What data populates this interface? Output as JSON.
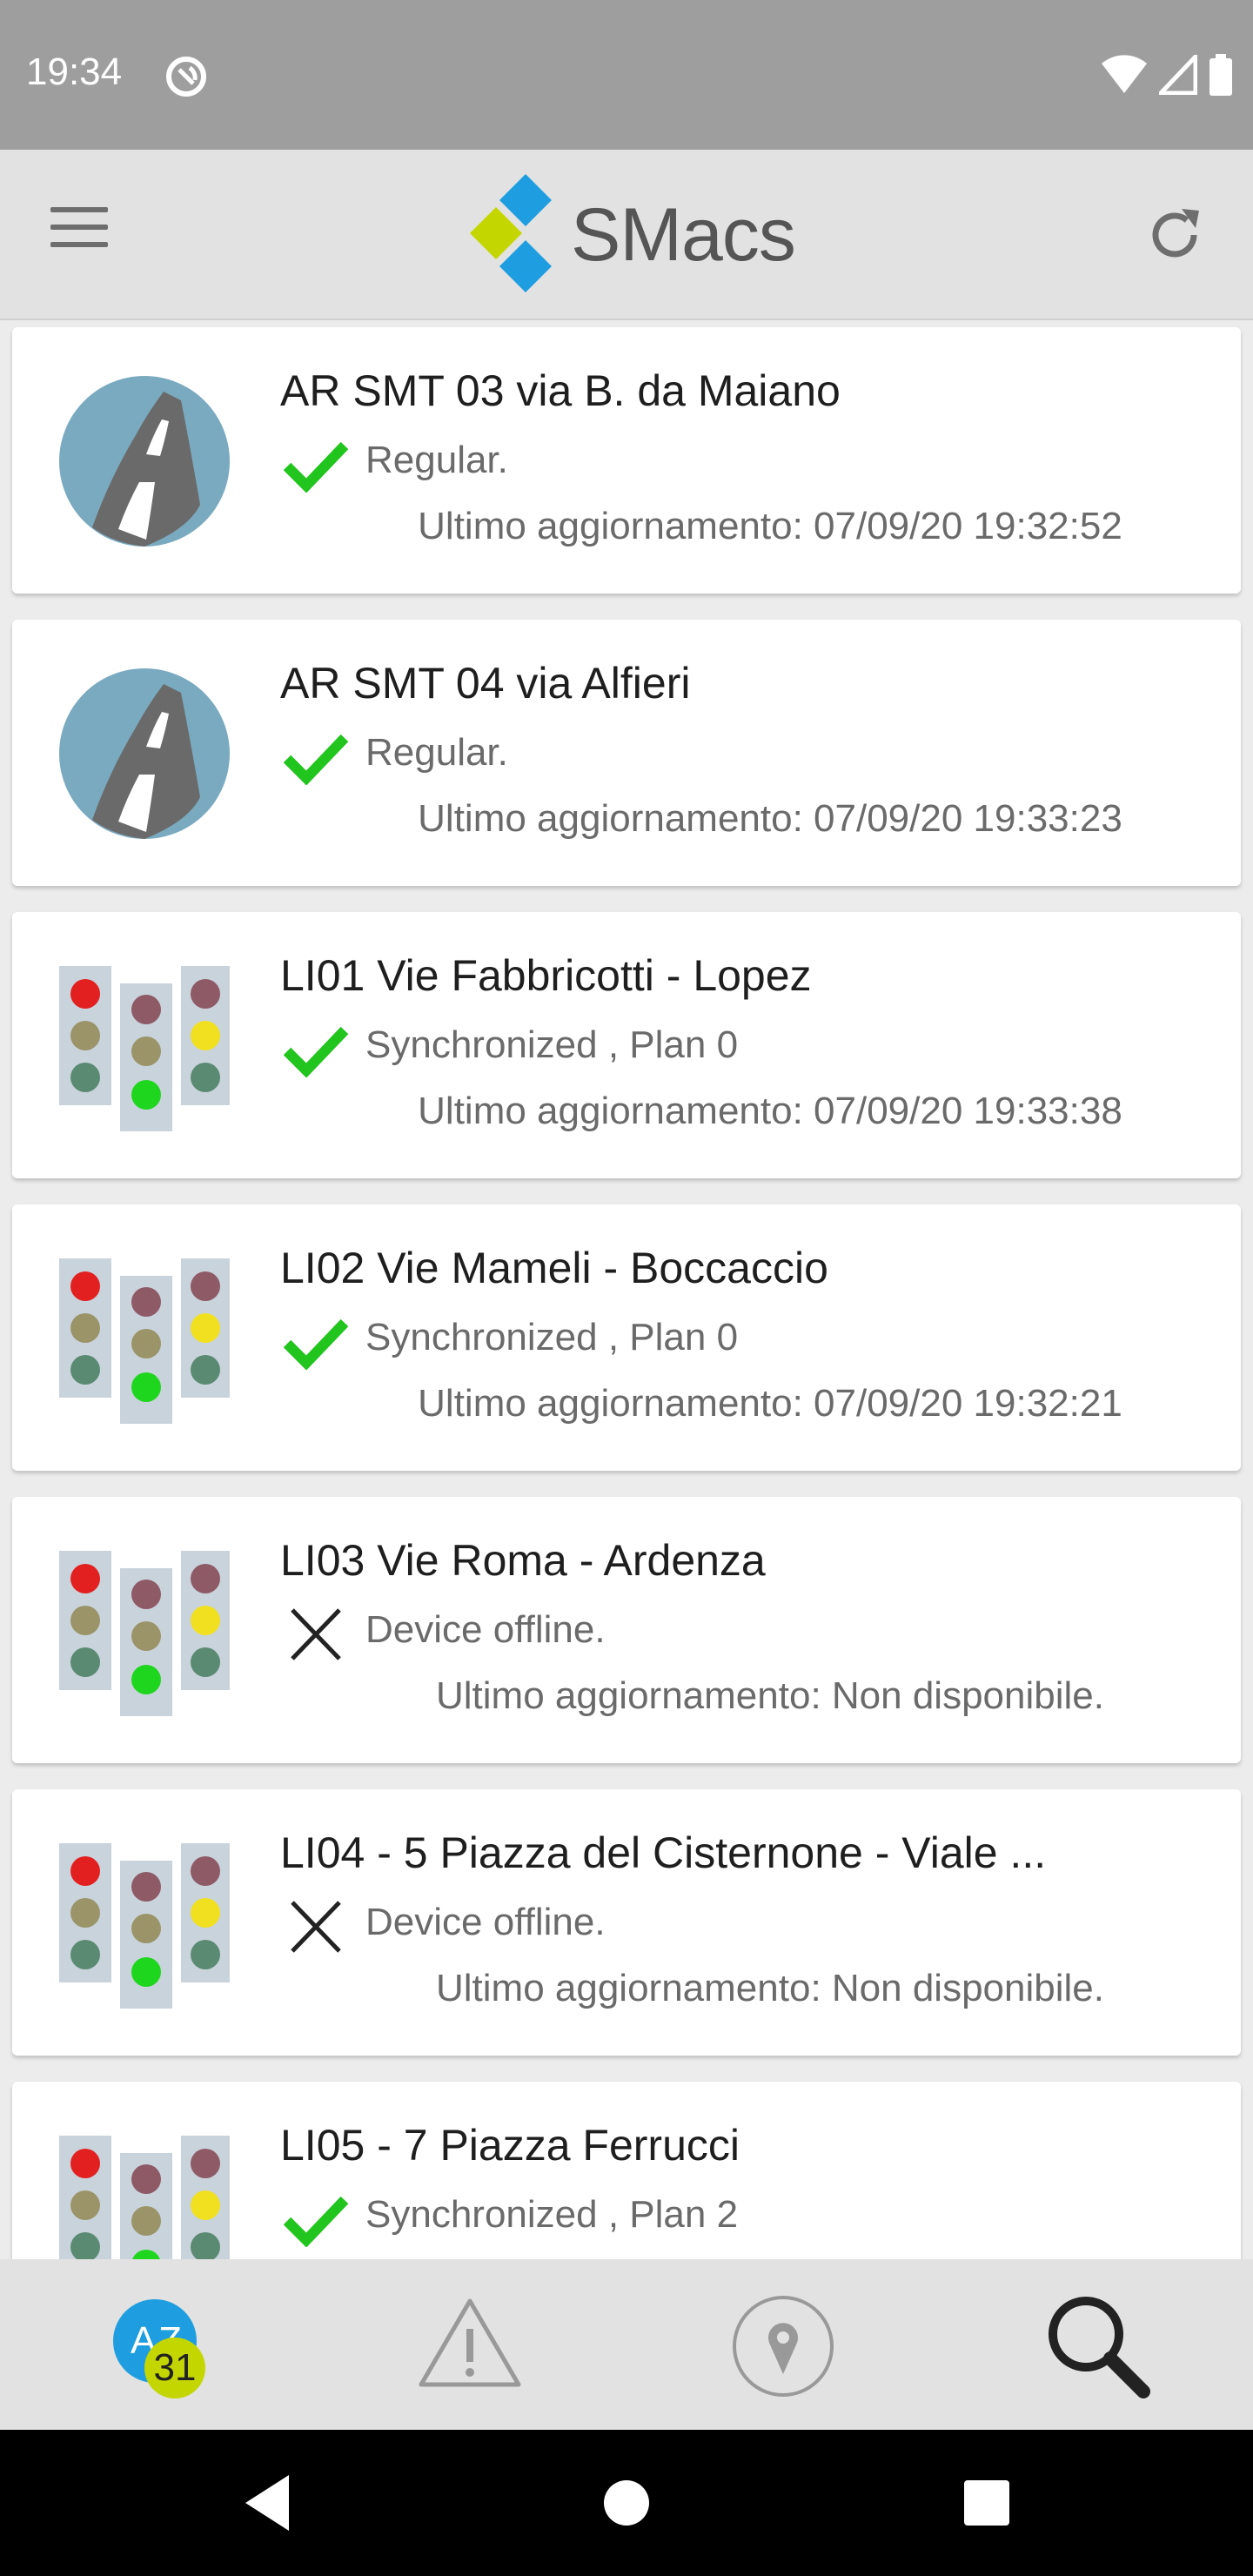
{
  "status_bar": {
    "time": "19:34",
    "sync_icon": "sync-icon",
    "wifi_icon": "wifi-icon",
    "signal_icon": "signal-icon",
    "battery_icon": "battery-icon"
  },
  "app_bar": {
    "title": "SMacs",
    "menu_icon": "menu-icon",
    "refresh_icon": "refresh-icon"
  },
  "colors": {
    "accent_green": "#22c41e",
    "logo_blue": "#1e9ee0",
    "logo_lime": "#c4d600",
    "badge": "#c4d600"
  },
  "devices": [
    {
      "title": "AR SMT 03 via B. da Maiano",
      "icon": "road-icon",
      "status_icon": "check-icon",
      "status": "Regular.",
      "update": "Ultimo aggiornamento: 07/09/20 19:32:52"
    },
    {
      "title": "AR SMT 04 via Alfieri",
      "icon": "road-icon",
      "status_icon": "check-icon",
      "status": "Regular.",
      "update": "Ultimo aggiornamento: 07/09/20 19:33:23"
    },
    {
      "title": "LI01 Vie Fabbricotti - Lopez",
      "icon": "traffic-light-icon",
      "status_icon": "check-icon",
      "status": "Synchronized , Plan 0",
      "update": "Ultimo aggiornamento: 07/09/20 19:33:38"
    },
    {
      "title": "LI02 Vie Mameli - Boccaccio",
      "icon": "traffic-light-icon",
      "status_icon": "check-icon",
      "status": "Synchronized , Plan 0",
      "update": "Ultimo aggiornamento: 07/09/20 19:32:21"
    },
    {
      "title": "LI03 Vie Roma - Ardenza",
      "icon": "traffic-light-icon",
      "status_icon": "offline-x-icon",
      "status": "Device offline.",
      "update": "Ultimo aggiornamento: Non disponibile."
    },
    {
      "title": "LI04 - 5 Piazza del Cisternone - Viale ...",
      "icon": "traffic-light-icon",
      "status_icon": "offline-x-icon",
      "status": "Device offline.",
      "update": "Ultimo aggiornamento: Non disponibile."
    },
    {
      "title": "LI05 - 7 Piazza Ferrucci",
      "icon": "traffic-light-icon",
      "status_icon": "check-icon",
      "status": "Synchronized , Plan 2",
      "update": ""
    }
  ],
  "tabs": [
    {
      "name": "az-list-tab",
      "icon": "az-list-icon",
      "badge": "31"
    },
    {
      "name": "alarms-tab",
      "icon": "warning-icon"
    },
    {
      "name": "map-tab",
      "icon": "location-pin-icon"
    },
    {
      "name": "search-tab",
      "icon": "search-icon"
    }
  ],
  "nav_bar": {
    "back_icon": "back-icon",
    "home_icon": "home-icon",
    "recents_icon": "recents-icon"
  }
}
